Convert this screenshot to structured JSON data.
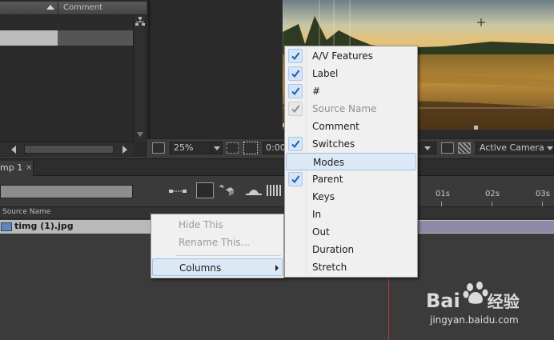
{
  "project_panel": {
    "column_header": "Comment"
  },
  "viewer": {
    "zoom": "25%",
    "time": "0:00",
    "camera": "Active Camera"
  },
  "timeline": {
    "tab_label": "mp 1",
    "tab_close": "×",
    "column_header": "Source Name",
    "layer_name": "timg (1).jpg",
    "ruler": [
      "01s",
      "02s",
      "03s"
    ]
  },
  "layer_menu": {
    "items": [
      {
        "label": "Hide This",
        "enabled": false
      },
      {
        "label": "Rename This...",
        "enabled": false
      },
      {
        "label": "Columns",
        "enabled": true,
        "highlighted": true,
        "submenu": true
      }
    ]
  },
  "columns_menu": {
    "items": [
      {
        "label": "A/V Features",
        "checked": true,
        "enabled": true
      },
      {
        "label": "Label",
        "checked": true,
        "enabled": true
      },
      {
        "label": "#",
        "checked": true,
        "enabled": true
      },
      {
        "label": "Source Name",
        "checked": true,
        "enabled": false
      },
      {
        "label": "Comment",
        "checked": false,
        "enabled": true
      },
      {
        "label": "Switches",
        "checked": true,
        "enabled": true
      },
      {
        "label": "Modes",
        "checked": false,
        "enabled": true,
        "highlighted": true
      },
      {
        "label": "Parent",
        "checked": true,
        "enabled": true
      },
      {
        "label": "Keys",
        "checked": false,
        "enabled": true
      },
      {
        "label": "In",
        "checked": false,
        "enabled": true
      },
      {
        "label": "Out",
        "checked": false,
        "enabled": true
      },
      {
        "label": "Duration",
        "checked": false,
        "enabled": true
      },
      {
        "label": "Stretch",
        "checked": false,
        "enabled": true
      }
    ]
  },
  "watermark": {
    "brand": "Bai",
    "brand_suffix": "经验",
    "url": "jingyan.baidu.com"
  },
  "colors": {
    "check_mark": "#1f5fb5",
    "menu_highlight": "#dce8f5",
    "layer_bar": "#8d89a7",
    "playhead": "#c03434"
  }
}
